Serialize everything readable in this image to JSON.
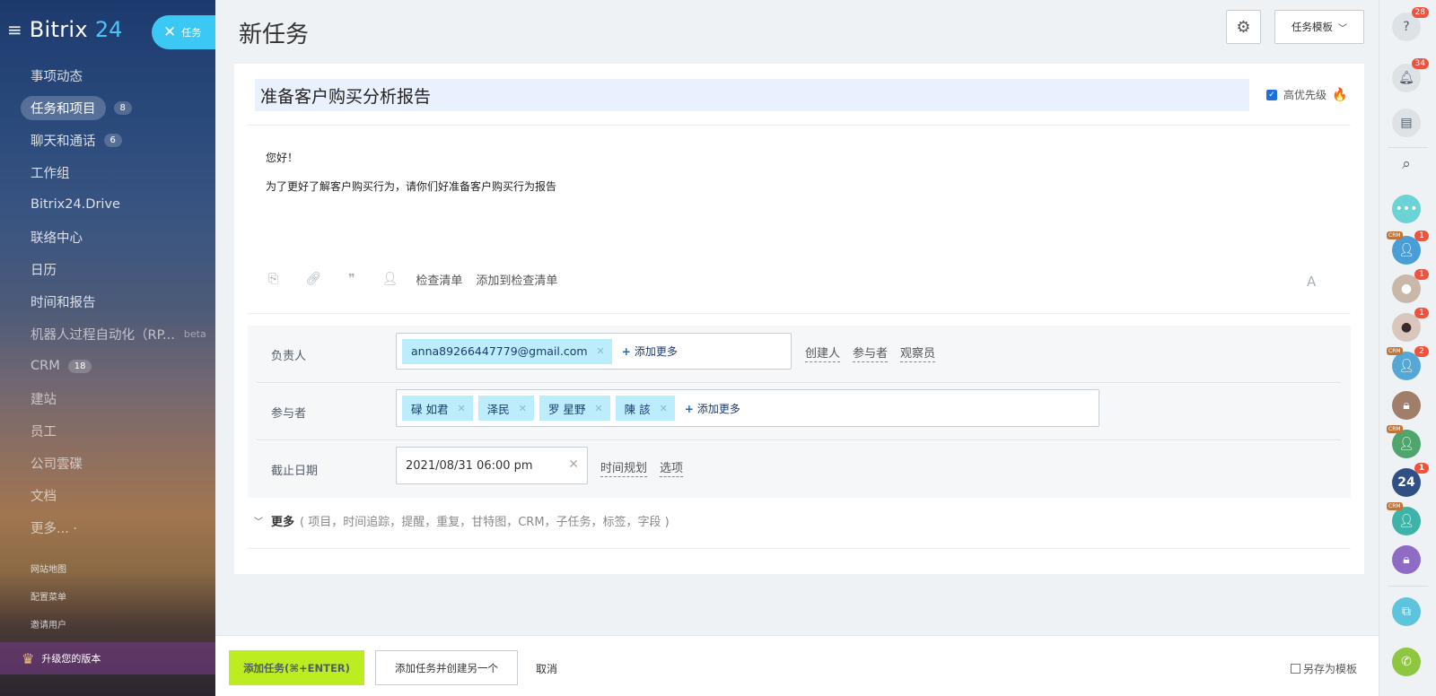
{
  "sidebar": {
    "brand": "Bitrix",
    "brand_num": "24",
    "close_pill_label": "任务",
    "items": [
      {
        "label": "事项动态"
      },
      {
        "label": "任务和项目",
        "count": "8"
      },
      {
        "label": "聊天和通话",
        "count": "6"
      },
      {
        "label": "工作组"
      },
      {
        "label": "Bitrix24.Drive"
      },
      {
        "label": "联络中心"
      },
      {
        "label": "日历"
      },
      {
        "label": "时间和报告"
      },
      {
        "label": "机器人过程自动化（RP...",
        "beta": "beta"
      },
      {
        "label": "CRM",
        "count": "18"
      },
      {
        "label": "建站"
      },
      {
        "label": "员工"
      },
      {
        "label": "公司雲碟"
      },
      {
        "label": "文档"
      },
      {
        "label": "更多... ·"
      }
    ],
    "sub_links": [
      "网站地图",
      "配置菜单",
      "邀请用户"
    ],
    "upgrade": "升级您的版本"
  },
  "header": {
    "title": "新任务",
    "template_btn": "任务模板"
  },
  "task": {
    "title": "准备客户购买分析报告",
    "priority_label": "高优先级",
    "body": [
      "您好！",
      "为了更好了解客户购买行为，请你们好准备客户购买行为报告"
    ],
    "toolbar": {
      "checklist": "检查清单",
      "add_to_checklist": "添加到检查清单",
      "font": "A"
    }
  },
  "fields": {
    "responsible": {
      "label": "负责人",
      "chips": [
        "anna89266447779@gmail.com"
      ],
      "add_more": "添加更多",
      "roles": [
        "创建人",
        "参与者",
        "观察员"
      ]
    },
    "participants": {
      "label": "参与者",
      "chips": [
        "碌 如君",
        "泽民",
        "罗 星野",
        "陳 該"
      ],
      "add_more": "添加更多"
    },
    "deadline": {
      "label": "截止日期",
      "value": "2021/08/31 06:00 pm",
      "links": [
        "时间规划",
        "选项"
      ]
    }
  },
  "more": {
    "label": "更多",
    "hint": "( 项目，时间追踪，提醒，重复，甘特图，CRM，子任务，标签，字段 )"
  },
  "bottom": {
    "add_task": "添加任务(⌘+ENTER)",
    "add_and_create": "添加任务并创建另一个",
    "cancel": "取消",
    "save_template": "另存为模板"
  },
  "rightbar": {
    "help_badge": "28",
    "bell_badge": "34",
    "contacts": [
      {
        "badge": "1",
        "crm": "CRM"
      },
      {
        "badge": "1"
      },
      {
        "badge": "1"
      },
      {
        "badge": "2",
        "crm": "CRM"
      },
      {},
      {
        "crm": "CRM"
      },
      {
        "badge": "1",
        "label": "24"
      },
      {
        "crm": "CRM"
      },
      {}
    ]
  }
}
